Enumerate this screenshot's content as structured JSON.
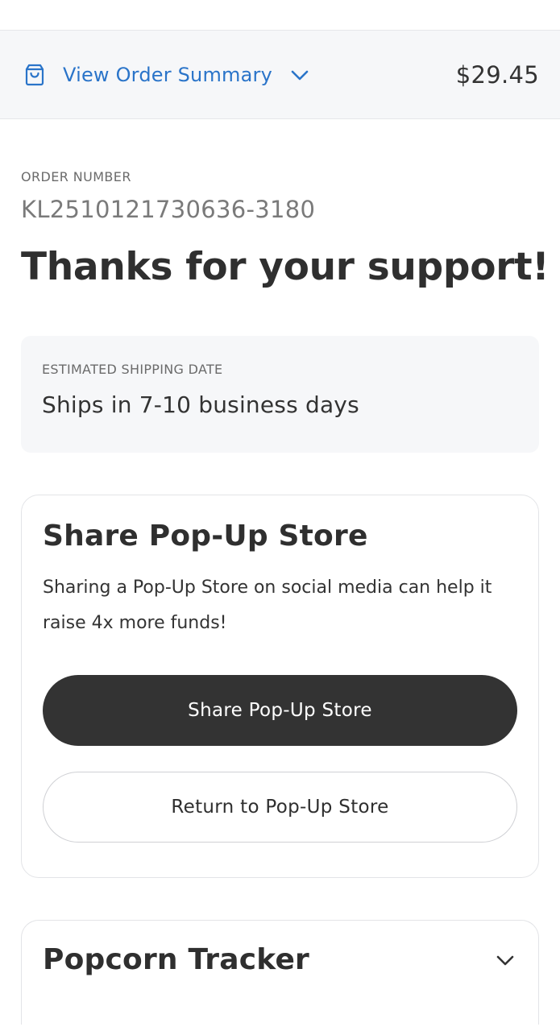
{
  "summary_bar": {
    "icon": "shopping-bag-icon",
    "toggle_label": "View Order Summary",
    "toggle_icon": "chevron-down-icon",
    "total": "$29.45",
    "link_color": "#2a74c9"
  },
  "order": {
    "number_label": "ORDER NUMBER",
    "number_value": "KL2510121730636-3180",
    "heading": "Thanks for your support!"
  },
  "shipping": {
    "label": "ESTIMATED SHIPPING DATE",
    "value": "Ships in 7-10 business days"
  },
  "share_card": {
    "title": "Share Pop-Up Store",
    "description": "Sharing a Pop-Up Store on social media can help it raise 4x more funds!",
    "primary_button": "Share Pop-Up Store",
    "secondary_button": "Return to Pop-Up Store"
  },
  "tracker_card": {
    "title": "Popcorn Tracker",
    "icon": "chevron-down-icon"
  }
}
